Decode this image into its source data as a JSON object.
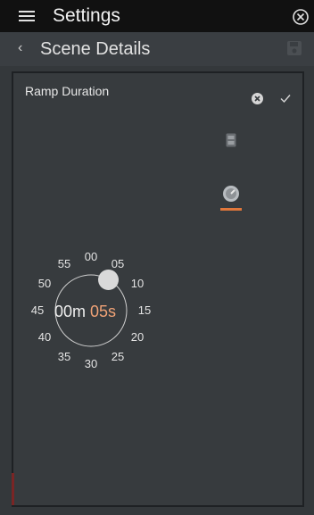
{
  "app": {
    "title": "Settings"
  },
  "header": {
    "back_label": "‹",
    "title": "Scene Details"
  },
  "dialog": {
    "title": "Ramp Duration",
    "time_minutes": "00m",
    "time_seconds": "05s",
    "selected_seconds": 5,
    "ticks": [
      "00",
      "05",
      "10",
      "15",
      "20",
      "25",
      "30",
      "35",
      "40",
      "45",
      "50",
      "55"
    ]
  },
  "colors": {
    "accent": "#e0773b",
    "seconds_text": "#f0a276",
    "topbar_bg": "#111111",
    "panel_bg": "#373b3e"
  },
  "icons": {
    "menu": "hamburger-menu-icon",
    "close": "close-circle-icon",
    "save": "save-icon",
    "cancel": "cancel-x-icon",
    "confirm": "checkmark-icon",
    "mode_device": "device-icon",
    "mode_dial": "dial-icon"
  }
}
